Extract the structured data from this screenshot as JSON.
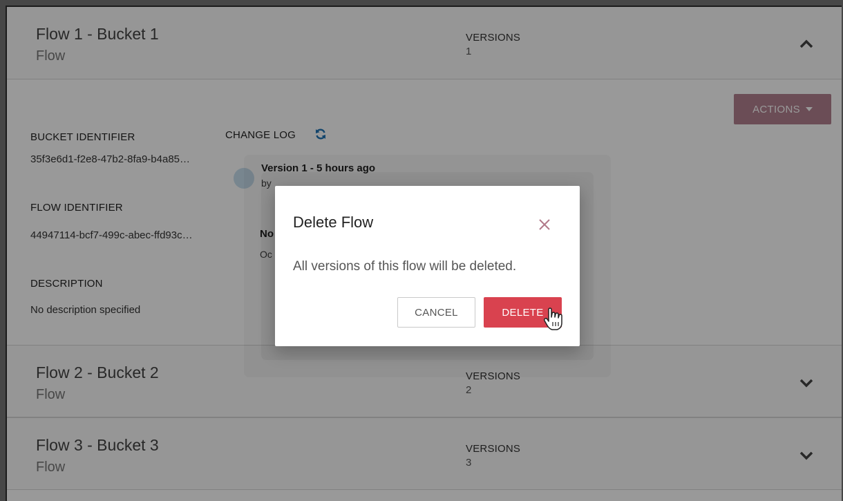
{
  "flows": [
    {
      "title": "Flow 1 - Bucket 1",
      "type": "Flow",
      "versions_label": "VERSIONS",
      "versions": "1",
      "expanded": true
    },
    {
      "title": "Flow 2 - Bucket 2",
      "type": "Flow",
      "versions_label": "VERSIONS",
      "versions": "2",
      "expanded": false
    },
    {
      "title": "Flow 3 - Bucket 3",
      "type": "Flow",
      "versions_label": "VERSIONS",
      "versions": "3",
      "expanded": false
    }
  ],
  "detail": {
    "actions_label": "ACTIONS",
    "bucket_identifier_label": "BUCKET IDENTIFIER",
    "bucket_identifier": "35f3e6d1-f2e8-47b2-8fa9-b4a85…",
    "flow_identifier_label": "FLOW IDENTIFIER",
    "flow_identifier": "44947114-bcf7-499c-abec-ffd93c…",
    "description_label": "DESCRIPTION",
    "description": "No description specified",
    "change_log_label": "CHANGE LOG",
    "change_log": [
      {
        "title": "Version 1 - 5 hours ago",
        "by": "by"
      }
    ],
    "partial_text": [
      "No",
      "Oc"
    ]
  },
  "dialog": {
    "title": "Delete Flow",
    "message": "All versions of this flow will be deleted.",
    "cancel_label": "CANCEL",
    "delete_label": "DELETE"
  },
  "colors": {
    "actions_button": "#b3808f",
    "delete_button": "#d9424f",
    "close_icon": "#b27a8a",
    "refresh_icon": "#1e73b5",
    "overlay": "rgba(0,0,0,0.40)"
  },
  "icons": {
    "expanded_chevron": "chevron-up-icon",
    "collapsed_chevron": "chevron-down-icon",
    "refresh": "refresh-icon",
    "close": "close-icon",
    "cursor": "hand-pointer-icon"
  }
}
